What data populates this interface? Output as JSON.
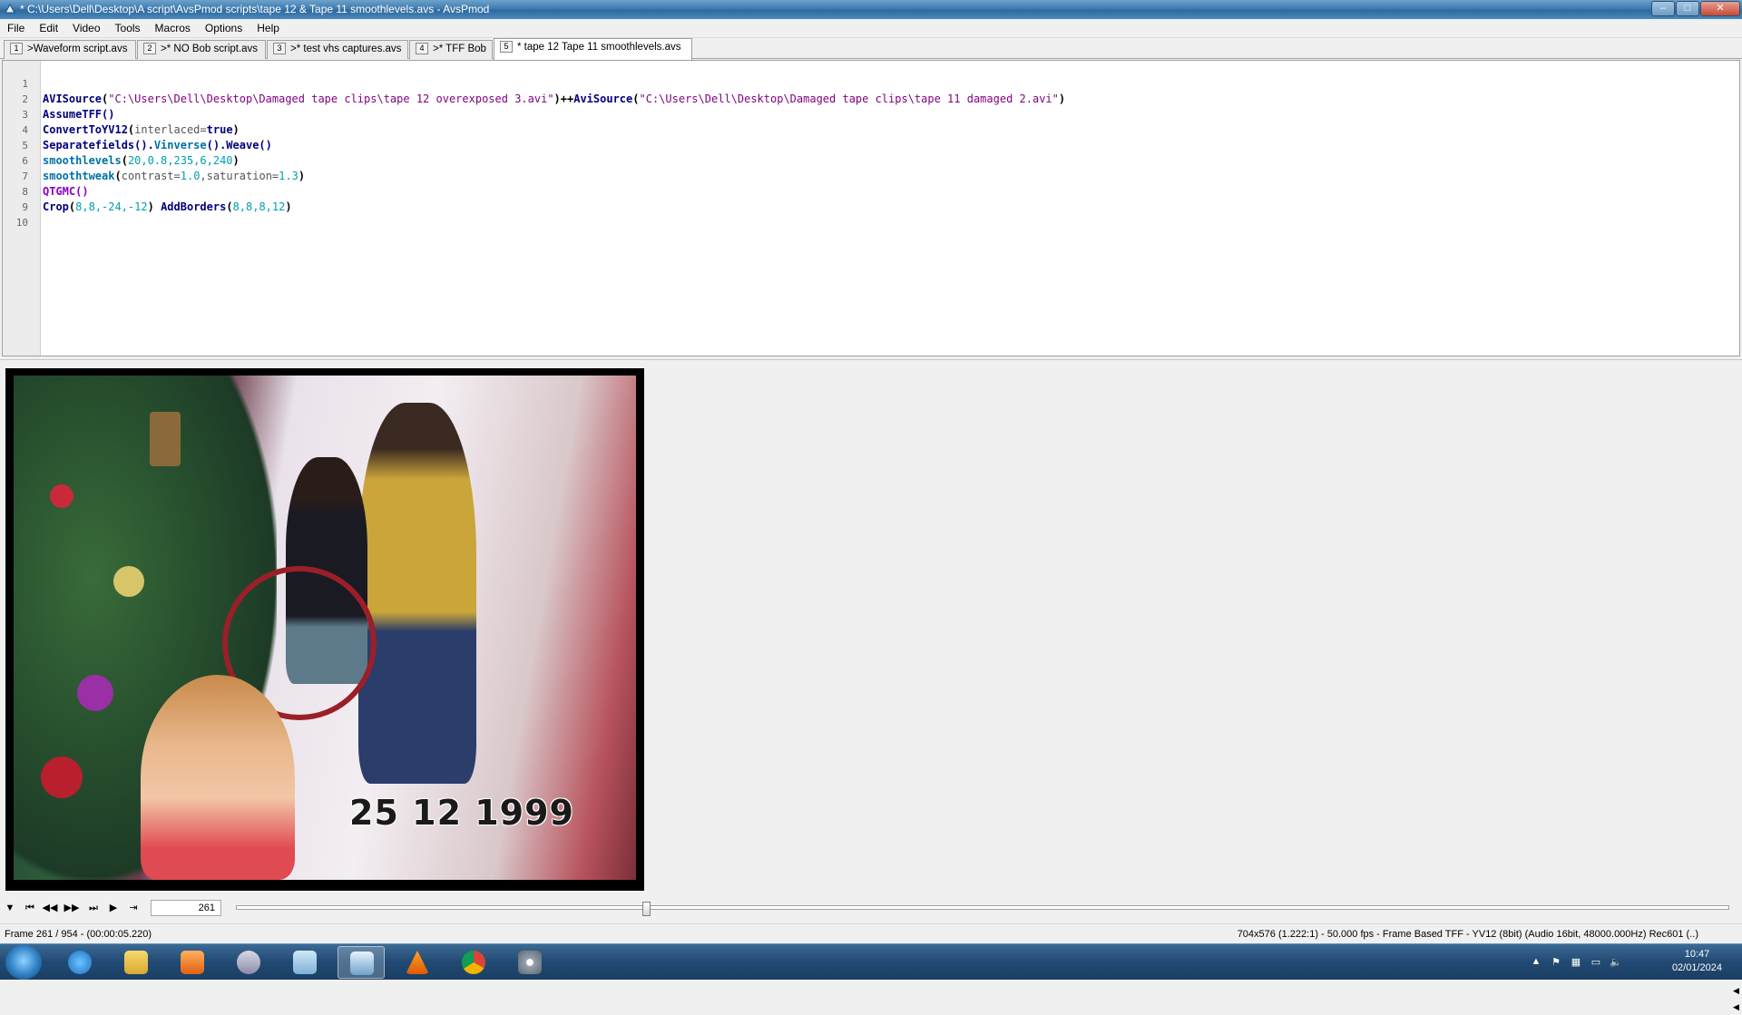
{
  "window": {
    "title": "* C:\\Users\\Dell\\Desktop\\A script\\AvsPmod scripts\\tape 12 & Tape 11 smoothlevels.avs - AvsPmod",
    "minimize": "–",
    "maximize": "□",
    "close": "✕"
  },
  "menu": [
    "File",
    "Edit",
    "Video",
    "Tools",
    "Macros",
    "Options",
    "Help"
  ],
  "tabs": [
    {
      "num": "1",
      "label": ">Waveform script.avs"
    },
    {
      "num": "2",
      "label": ">* NO Bob script.avs"
    },
    {
      "num": "3",
      "label": ">* test vhs captures.avs"
    },
    {
      "num": "4",
      "label": ">* TFF Bob"
    },
    {
      "num": "5",
      "label": "* tape 12  Tape 11 smoothlevels.avs"
    }
  ],
  "editor": {
    "line_numbers": [
      "1",
      "2",
      "3",
      "4",
      "5",
      "6",
      "7",
      "8",
      "9",
      "10"
    ],
    "line1": {
      "fn_a": "AVISource",
      "paren_a": "(",
      "str_a": "\"C:\\Users\\Dell\\Desktop\\Damaged tape clips\\tape 12 overexposed 3.avi\"",
      "concat": ")++",
      "fn_b": "AviSource",
      "paren_b": "(",
      "str_b": "\"C:\\Users\\Dell\\Desktop\\Damaged tape clips\\tape 11 damaged 2.avi\"",
      "close": ")"
    },
    "line2": "AssumeTFF()",
    "line3": {
      "fn": "ConvertToYV12",
      "open": "(",
      "param": "interlaced=",
      "val": "true",
      "close": ")"
    },
    "line4": {
      "a": "Separatefields().",
      "b": "Vinverse",
      "c": "().Weave()"
    },
    "line5": {
      "fn": "smoothlevels",
      "open": "(",
      "args": "20,0.8,235,6,240",
      "close": ")"
    },
    "line6": {
      "fn": "smoothtweak",
      "open": "(",
      "p1": "contrast=",
      "v1": "1.0",
      "comma": ",",
      "p2": "saturation=",
      "v2": "1.3",
      "close": ")"
    },
    "line7": "QTGMC()",
    "line8": {
      "fn1": "Crop",
      "open1": "(",
      "args1": "8,8,-24,-12",
      "close1": ") ",
      "fn2": "AddBorders",
      "open2": "(",
      "args2": "8,8,8,12",
      "close2": ")"
    }
  },
  "video": {
    "date_overlay": "25 12 1999"
  },
  "playback": {
    "frame_value": "261",
    "progress": 0.2736,
    "buttons": [
      "▼",
      "⏮",
      "◀◀",
      "▶▶",
      "⏭",
      "▶",
      "⇥"
    ]
  },
  "status": {
    "left": "Frame 261 / 954  -  (00:00:05.220)",
    "right": "704x576 (1.222:1) - 50.000 fps - Frame Based TFF - YV12 (8bit) (Audio 16bit, 48000.000Hz) Rec601 (..)"
  },
  "taskbar": {
    "icons": [
      "ie-icon",
      "explorer-icon",
      "media-player-icon",
      "snipping-icon",
      "notepad-icon",
      "avspmod-icon",
      "vlc-icon",
      "chrome-icon",
      "settings-icon"
    ],
    "clock_time": "10:47",
    "clock_date": "02/01/2024"
  },
  "colors": {
    "titlebar": "#3d7bb0",
    "taskbar": "#214a73",
    "function": "#00007f",
    "string": "#7f007f",
    "number": "#00a0b0"
  }
}
